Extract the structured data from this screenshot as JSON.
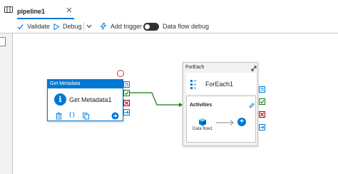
{
  "tab": {
    "title": "pipeline1"
  },
  "toolbar": {
    "validate_label": "Validate",
    "debug_label": "Debug",
    "add_trigger_label": "Add trigger",
    "data_flow_debug_label": "Data flow debug"
  },
  "activities": {
    "get_metadata": {
      "type_label": "Get Metadata",
      "name": "Get Metadata1"
    },
    "foreach": {
      "type_label": "ForEach",
      "name": "ForEach1",
      "activities_title": "Activities",
      "inner_activity_label": "Data flow1"
    }
  },
  "colors": {
    "accent": "#0078d4",
    "success": "#107c10",
    "failure": "#a80000",
    "connector": "#107c10"
  }
}
